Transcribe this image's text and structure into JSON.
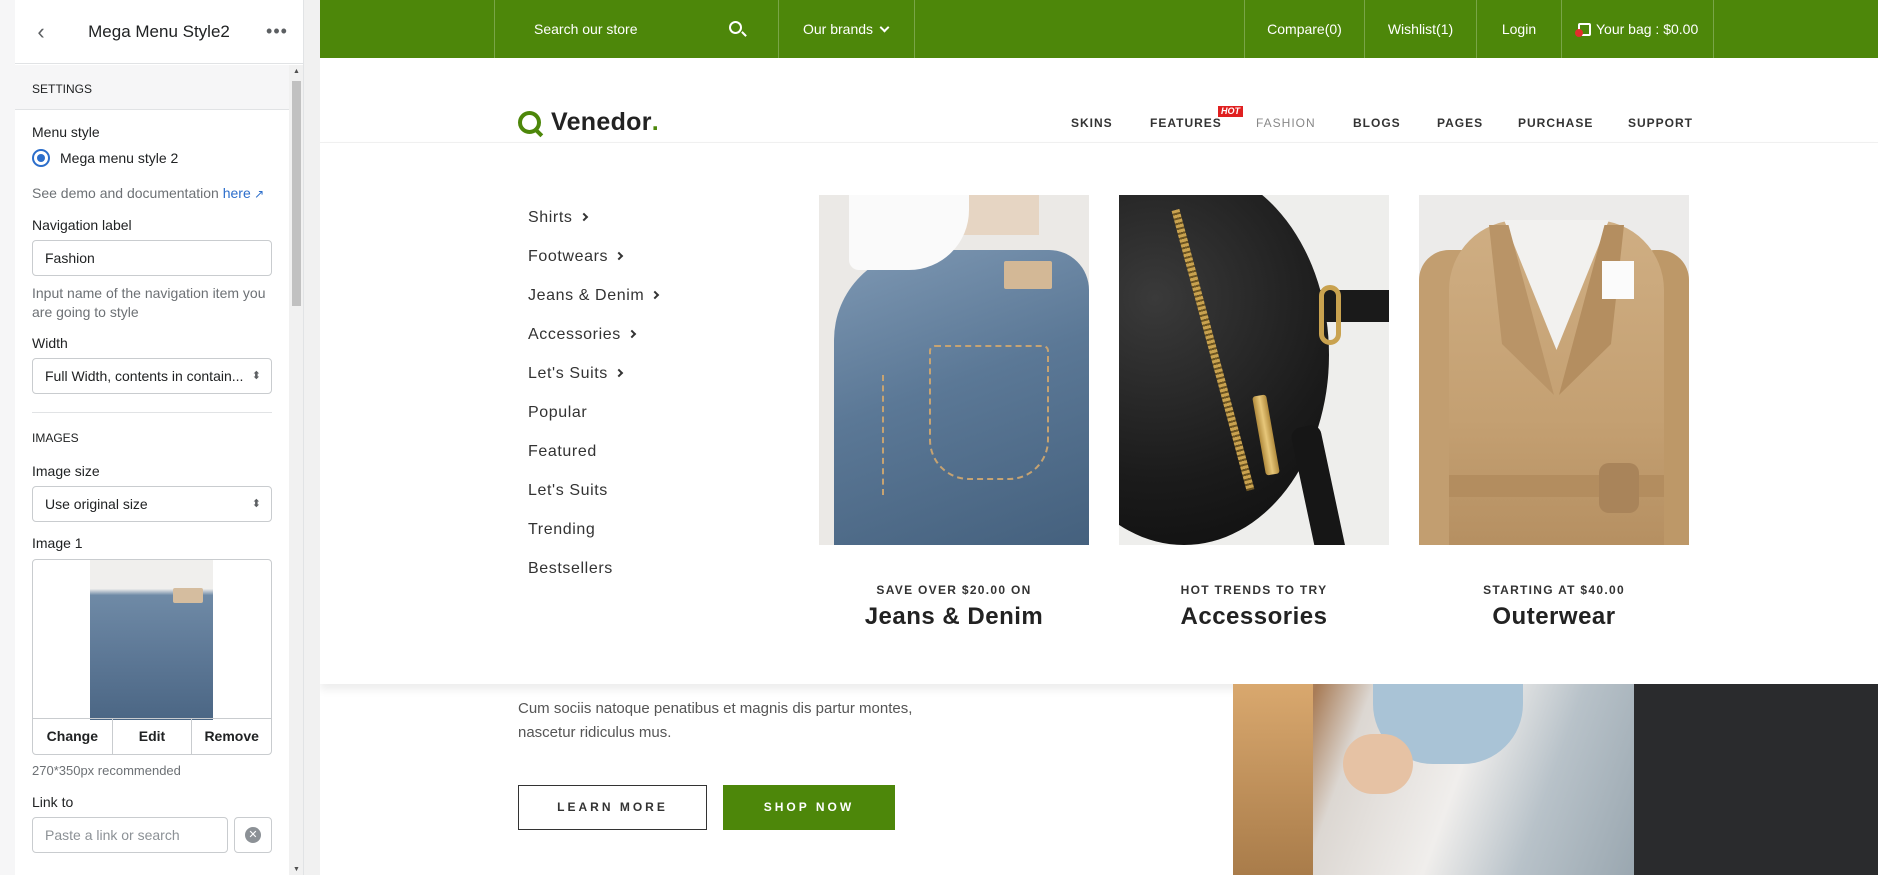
{
  "panel": {
    "title": "Mega Menu Style2",
    "settings_heading": "SETTINGS",
    "menu_style_label": "Menu style",
    "menu_style_option": "Mega menu style 2",
    "demo_text": "See demo and documentation ",
    "demo_link": "here",
    "nav_label_label": "Navigation label",
    "nav_label_value": "Fashion",
    "nav_label_help": "Input name of the navigation item you are going to style",
    "width_label": "Width",
    "width_value": "Full Width, contents in contain...",
    "images_heading": "IMAGES",
    "image_size_label": "Image size",
    "image_size_value": "Use original size",
    "image1_label": "Image 1",
    "image_actions": [
      "Change",
      "Edit",
      "Remove"
    ],
    "image_recommend": "270*350px recommended",
    "link_to_label": "Link to",
    "link_placeholder": "Paste a link or search"
  },
  "topbar": {
    "search_placeholder": "Search our store",
    "brands": "Our brands",
    "compare": "Compare(0)",
    "wishlist": "Wishlist(1)",
    "login": "Login",
    "bag": "Your bag : $0.00",
    "bg_color": "#4d870a"
  },
  "logo": {
    "name": "Venedor",
    "dot": "."
  },
  "nav": {
    "items": [
      "SKINS",
      "FEATURES",
      "FASHION",
      "BLOGS",
      "PAGES",
      "PURCHASE",
      "SUPPORT"
    ],
    "hot_badge": "hot",
    "active": "FASHION"
  },
  "mega": {
    "links": [
      "Shirts",
      "Footwears",
      "Jeans & Denim",
      "Accessories",
      "Let's Suits",
      "Popular",
      "Featured",
      "Let's Suits",
      "Trending",
      "Bestsellers"
    ],
    "promos": [
      {
        "kicker": "SAVE OVER $20.00 ON",
        "title": "Jeans & Denim"
      },
      {
        "kicker": "HOT TRENDS TO TRY",
        "title": "Accessories"
      },
      {
        "kicker": "STARTING AT $40.00",
        "title": "Outerwear"
      }
    ]
  },
  "hero": {
    "text": "Cum sociis natoque penatibus et magnis dis partur montes, nascetur ridiculus mus.",
    "learn_more": "LEARN MORE",
    "shop_now": "SHOP NOW"
  }
}
